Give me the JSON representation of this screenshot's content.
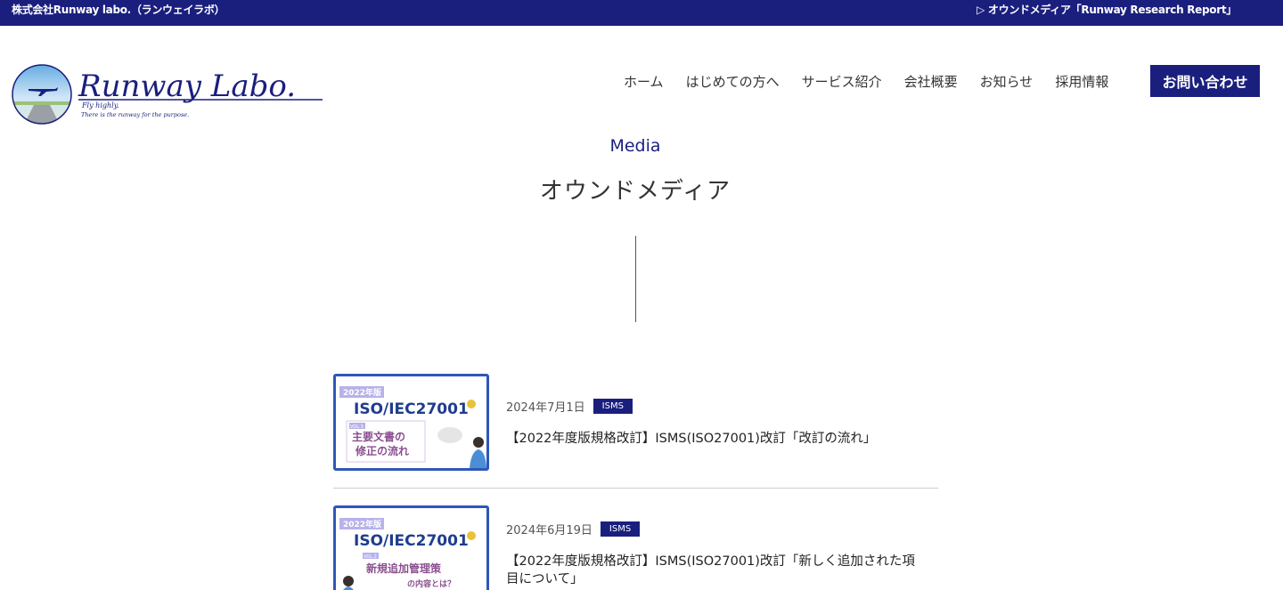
{
  "topbar": {
    "company": "株式会社Runway labo.（ランウェイラボ）",
    "media_link": "▷ オウンドメディア「Runway Research Report」"
  },
  "logo": {
    "wordmark": "Runway Labo.",
    "tagline_1": "Fly highly.",
    "tagline_2": "There is the runway for the purpose."
  },
  "nav": {
    "items": [
      "ホーム",
      "はじめての方へ",
      "サービス紹介",
      "会社概要",
      "お知らせ",
      "採用情報"
    ],
    "contact": "お問い合わせ"
  },
  "section": {
    "label": "Media",
    "title": "オウンドメディア"
  },
  "articles": [
    {
      "date": "2024年7月1日",
      "tag": "ISMS",
      "title": "【2022年度版規格改訂】ISMS(ISO27001)改訂「改訂の流れ」",
      "thumb": {
        "badge": "2022年版",
        "heading": "ISO/IEC27001",
        "vol": "VOL.3",
        "line1": "主要文書の",
        "line2": "修正の流れ"
      }
    },
    {
      "date": "2024年6月19日",
      "tag": "ISMS",
      "title": "【2022年度版規格改訂】ISMS(ISO27001)改訂「新しく追加された項目について」",
      "thumb": {
        "badge": "2022年版",
        "heading": "ISO/IEC27001",
        "vol": "VOL.2",
        "line1": "新規追加管理策",
        "line2": "の内容とは？"
      }
    }
  ],
  "colors": {
    "brand_navy": "#1a1f7e",
    "thumb_border": "#2e57b8",
    "thumb_text_purple": "#8a4f8f"
  }
}
